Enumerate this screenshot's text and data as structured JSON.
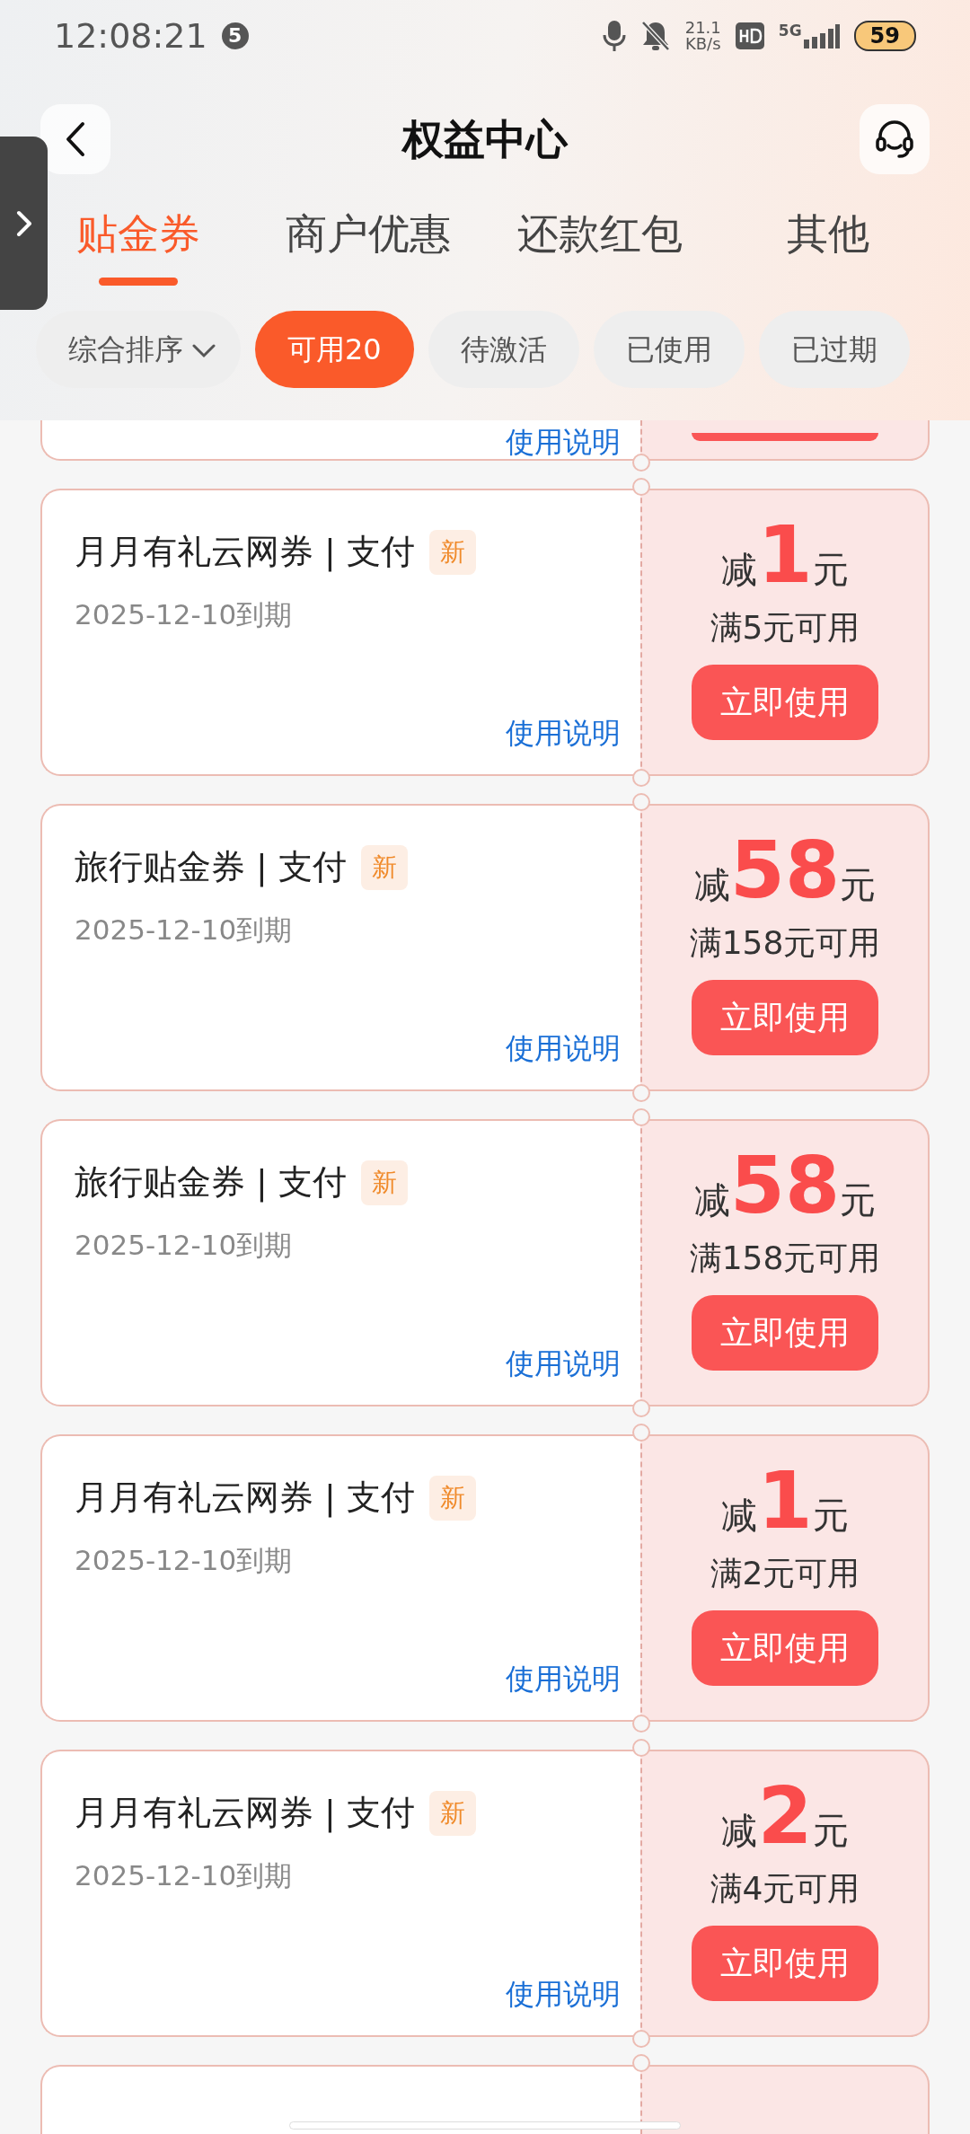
{
  "status_bar": {
    "time": "12:08:21",
    "notification_count": "5",
    "speed_value": "21.1",
    "speed_unit": "KB/s",
    "network": "5G",
    "battery": "59"
  },
  "header": {
    "title": "权益中心"
  },
  "tabs": [
    {
      "label": "贴金券",
      "selected": true
    },
    {
      "label": "商户优惠",
      "selected": false
    },
    {
      "label": "还款红包",
      "selected": false
    },
    {
      "label": "其他",
      "selected": false
    }
  ],
  "filters": [
    {
      "label": "综合排序",
      "kind": "dropdown",
      "selected": false
    },
    {
      "label": "可用20",
      "kind": "chip",
      "selected": true
    },
    {
      "label": "待激活",
      "kind": "chip",
      "selected": false
    },
    {
      "label": "已使用",
      "kind": "chip",
      "selected": false
    },
    {
      "label": "已过期",
      "kind": "chip",
      "selected": false
    }
  ],
  "partial_card": {
    "link": "使用说明"
  },
  "coupons": [
    {
      "title": "月月有礼云网券 | 支付",
      "badge": "新",
      "date": "2025-12-10到期",
      "link": "使用说明",
      "prefix": "减",
      "amount": "1",
      "unit": "元",
      "condition": "满5元可用",
      "button": "立即使用"
    },
    {
      "title": "旅行贴金券 | 支付",
      "badge": "新",
      "date": "2025-12-10到期",
      "link": "使用说明",
      "prefix": "减",
      "amount": "58",
      "unit": "元",
      "condition": "满158元可用",
      "button": "立即使用"
    },
    {
      "title": "旅行贴金券 | 支付",
      "badge": "新",
      "date": "2025-12-10到期",
      "link": "使用说明",
      "prefix": "减",
      "amount": "58",
      "unit": "元",
      "condition": "满158元可用",
      "button": "立即使用"
    },
    {
      "title": "月月有礼云网券 | 支付",
      "badge": "新",
      "date": "2025-12-10到期",
      "link": "使用说明",
      "prefix": "减",
      "amount": "1",
      "unit": "元",
      "condition": "满2元可用",
      "button": "立即使用"
    },
    {
      "title": "月月有礼云网券 | 支付",
      "badge": "新",
      "date": "2025-12-10到期",
      "link": "使用说明",
      "prefix": "减",
      "amount": "2",
      "unit": "元",
      "condition": "满4元可用",
      "button": "立即使用"
    }
  ]
}
